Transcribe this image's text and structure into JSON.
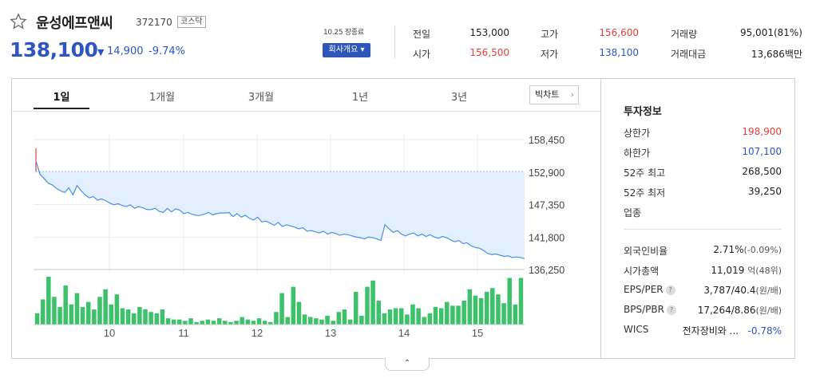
{
  "stock": {
    "name": "윤성에프앤씨",
    "code": "372170",
    "market": "코스닥",
    "price": "138,100",
    "change_arrow": "▼",
    "change": "14,900",
    "change_pct": "-9.74%"
  },
  "time_info": "10.25 장종료",
  "company_btn": "회사개요 ▾",
  "quote": {
    "prev_close_label": "전일",
    "prev_close": "153,000",
    "high_label": "고가",
    "high": "156,600",
    "volume_label": "거래량",
    "volume": "95,001(81%)",
    "open_label": "시가",
    "open": "156,500",
    "low_label": "저가",
    "low": "138,100",
    "amount_label": "거래대금",
    "amount": "13,686백만"
  },
  "tabs": [
    "1일",
    "1개월",
    "3개월",
    "1년",
    "3년"
  ],
  "big_chart_btn": "빅차트",
  "info_panel": {
    "title": "투자정보",
    "upper_limit_label": "상한가",
    "upper_limit": "198,900",
    "lower_limit_label": "하한가",
    "lower_limit": "107,100",
    "w52_high_label": "52주 최고",
    "w52_high": "268,500",
    "w52_low_label": "52주 최저",
    "w52_low": "39,250",
    "industry_label": "업종",
    "foreign_ratio_label": "외국인비율",
    "foreign_ratio": "2.71%",
    "foreign_ratio_chg": "(-0.09%)",
    "market_cap_label": "시가총액",
    "market_cap": "11,019",
    "market_cap_unit": "억(48위)",
    "eps_per_label": "EPS/PER",
    "eps_per": "3,787/40.4",
    "eps_per_unit": "(원/배)",
    "bps_pbr_label": "BPS/PBR",
    "bps_pbr": "17,264/8.86",
    "bps_pbr_unit": "(원/배)",
    "wics_label": "WICS",
    "wics_name": "전자장비와 ...",
    "wics_pct": "-0.78%"
  },
  "colors": {
    "up": "#e8403a",
    "down": "#2f55c4",
    "line": "#4a90e2",
    "fill": "#e3efff",
    "volume": "#3dc26b"
  },
  "chart_data": {
    "type": "line",
    "y_ticks": [
      "158,450",
      "152,900",
      "147,350",
      "141,800",
      "136,250"
    ],
    "y_values": [
      158450,
      152900,
      147350,
      141800,
      136250
    ],
    "prev_close": 153000,
    "x_ticks": [
      "10",
      "11",
      "12",
      "13",
      "14",
      "15"
    ],
    "price_series": [
      154800,
      152500,
      151800,
      151000,
      150700,
      150100,
      149700,
      149400,
      150200,
      149000,
      150600,
      149700,
      149000,
      148500,
      148700,
      148100,
      148300,
      148000,
      147600,
      147300,
      147500,
      147200,
      147000,
      147300,
      146700,
      147000,
      146800,
      146500,
      146500,
      146700,
      146200,
      146000,
      146700,
      146100,
      146600,
      146400,
      145800,
      146000,
      145700,
      145500,
      145500,
      145700,
      146000,
      145600,
      145800,
      145900,
      145900,
      146000,
      145300,
      145800,
      145200,
      145500,
      145000,
      144700,
      145200,
      144400,
      144500,
      144200,
      143800,
      144300,
      143600,
      143900,
      143700,
      143500,
      143200,
      143400,
      142800,
      142900,
      142700,
      142500,
      142800,
      142300,
      142600,
      142400,
      142100,
      142300,
      142200,
      142000,
      141800,
      141700,
      141500,
      141800,
      141700,
      141500,
      141200,
      143900,
      143200,
      142600,
      142900,
      142300,
      142000,
      142300,
      142500,
      142000,
      142300,
      141900,
      142200,
      141800,
      141600,
      141900,
      141700,
      141300,
      141000,
      141200,
      140700,
      140800,
      140300,
      140000,
      139900,
      139500,
      139000,
      138800,
      138900,
      138700,
      138500,
      138600,
      138300,
      138400,
      138300,
      138100
    ],
    "volume_series": [
      9,
      20,
      38,
      22,
      14,
      31,
      16,
      25,
      14,
      18,
      12,
      22,
      28,
      16,
      24,
      13,
      12,
      9,
      14,
      12,
      10,
      9,
      12,
      5,
      4,
      4,
      3,
      5,
      2,
      3,
      4,
      3,
      5,
      3,
      2,
      3,
      6,
      4,
      3,
      5,
      3,
      2,
      10,
      25,
      6,
      30,
      18,
      8,
      6,
      5,
      4,
      7,
      3,
      10,
      12,
      4,
      26,
      7,
      30,
      35,
      19,
      9,
      12,
      13,
      13,
      8,
      16,
      13,
      6,
      9,
      14,
      13,
      18,
      15,
      15,
      19,
      28,
      23,
      21,
      26,
      29,
      24,
      17,
      37,
      16,
      37
    ]
  }
}
